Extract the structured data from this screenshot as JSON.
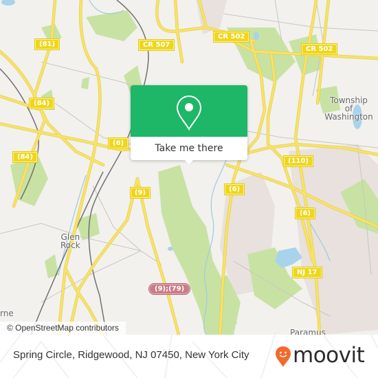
{
  "map": {
    "road_shields": [
      {
        "id": "81",
        "label": "(81)",
        "style": "yellow"
      },
      {
        "id": "cr507",
        "label": "CR 507",
        "style": "yellow"
      },
      {
        "id": "cr502-west",
        "label": "CR 502",
        "style": "yellow"
      },
      {
        "id": "cr502-east",
        "label": "CR 502",
        "style": "yellow"
      },
      {
        "id": "84-north",
        "label": "(84)",
        "style": "yellow"
      },
      {
        "id": "84-south",
        "label": "(84)",
        "style": "yellow"
      },
      {
        "id": "6-west",
        "label": "(6)",
        "style": "yellow"
      },
      {
        "id": "110",
        "label": "(110)",
        "style": "yellow"
      },
      {
        "id": "6-center",
        "label": "(6)",
        "style": "yellow"
      },
      {
        "id": "6-east",
        "label": "(6)",
        "style": "yellow"
      },
      {
        "id": "9",
        "label": "(9)",
        "style": "yellow"
      },
      {
        "id": "nj17",
        "label": "NJ 17",
        "style": "yellow"
      },
      {
        "id": "9-79",
        "label": "(9);(79)",
        "style": "pink"
      }
    ],
    "place_labels": {
      "township_line1": "Township",
      "township_line2": "of Washington",
      "glen_line1": "Glen",
      "glen_line2": "Rock",
      "paramus": "Paramus",
      "partial_west": "rne"
    },
    "colors": {
      "land": "#f2f1ed",
      "park": "#c8e2a4",
      "water": "#a9d3ea",
      "road": "#f7e36b",
      "urban": "#e8e1dd",
      "rail": "#707070"
    }
  },
  "popup": {
    "icon": "map-pin-icon",
    "button_label": "Take me there",
    "accent": "#1db767"
  },
  "attribution": "© OpenStreetMap contributors",
  "footer": {
    "address": "Spring Circle, Ridgewood, NJ 07450, New York City",
    "logo_text": "moovit",
    "logo_icon": "moovit-smiley-pin-icon",
    "logo_color": "#f26a2e"
  }
}
